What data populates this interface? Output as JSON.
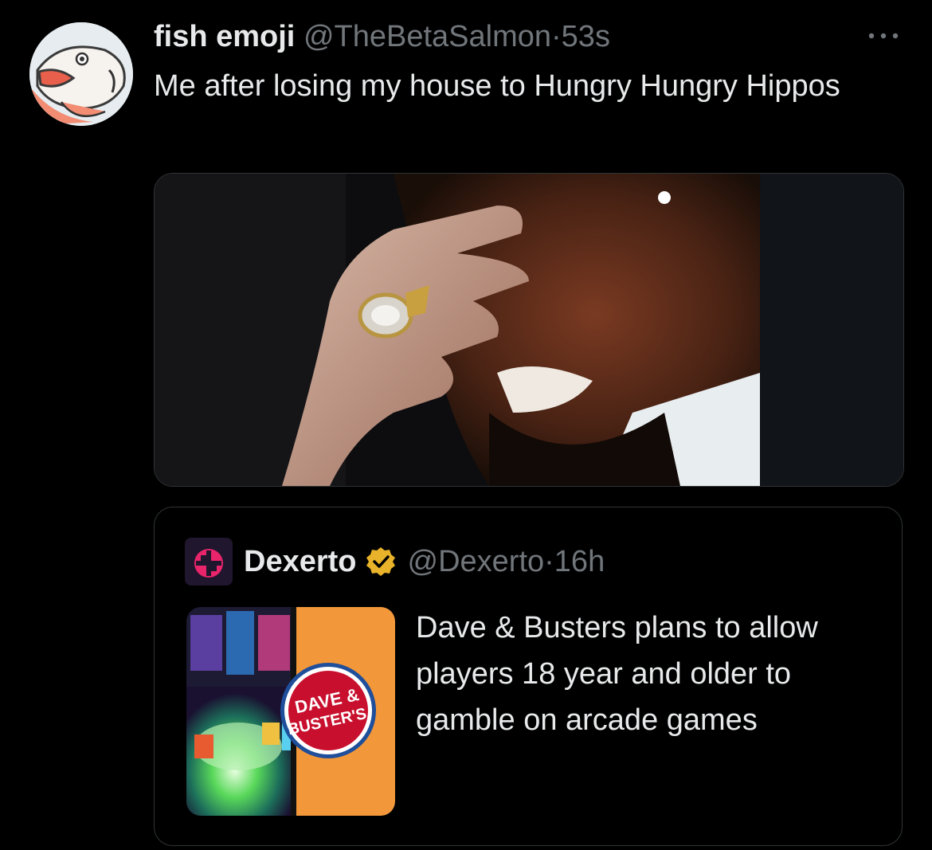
{
  "tweet": {
    "author_name": "fish emoji",
    "author_handle": "@TheBetaSalmon",
    "separator": "·",
    "time": "53s",
    "text": "Me after losing my house to Hungry Hungry Hippos",
    "avatar_icon": "salmon-avatar-icon",
    "more_icon": "more-options-icon"
  },
  "media": {
    "description_icon": "meme-image"
  },
  "quoted_tweet": {
    "author_name": "Dexerto",
    "author_handle": "@Dexerto",
    "separator": "·",
    "time": "16h",
    "verified_color": "#e8b32a",
    "text": "Dave & Busters plans to allow players 18 year and older to gamble on arcade games",
    "thumbnail_logo_line1": "DAVE &",
    "thumbnail_logo_line2": "BUSTER'S"
  },
  "colors": {
    "background": "#000000",
    "primary_text": "#e7e9ea",
    "secondary_text": "#71767b",
    "border": "#2f3336",
    "dave_busters_orange": "#f2973a",
    "dave_busters_red": "#c8102e"
  }
}
